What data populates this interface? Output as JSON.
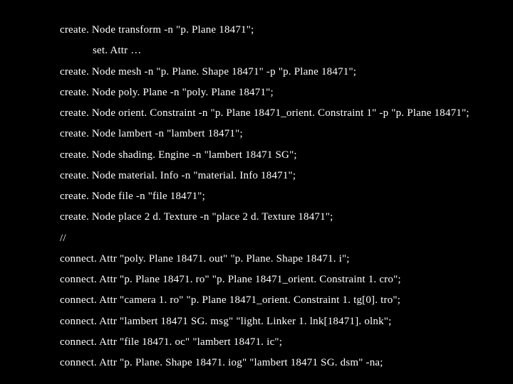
{
  "code": {
    "lines": [
      {
        "text": "create. Node transform -n \"p. Plane 18471\";",
        "indent": false
      },
      {
        "text": "set. Attr …",
        "indent": true
      },
      {
        "text": "create. Node mesh -n \"p. Plane. Shape 18471\" -p \"p. Plane 18471\";",
        "indent": false
      },
      {
        "text": "create. Node poly. Plane -n \"poly. Plane 18471\";",
        "indent": false
      },
      {
        "text": "create. Node orient. Constraint -n \"p. Plane 18471_orient. Constraint 1\" -p \"p. Plane 18471\";",
        "indent": false
      },
      {
        "text": "create. Node lambert -n \"lambert 18471\";",
        "indent": false
      },
      {
        "text": "create. Node shading. Engine -n \"lambert 18471 SG\";",
        "indent": false
      },
      {
        "text": "create. Node material. Info -n \"material. Info 18471\";",
        "indent": false
      },
      {
        "text": "create. Node file -n \"file 18471\";",
        "indent": false
      },
      {
        "text": "create. Node place 2 d. Texture -n \"place 2 d. Texture 18471\";",
        "indent": false
      },
      {
        "text": "//",
        "indent": false
      },
      {
        "text": "connect. Attr \"poly. Plane 18471. out\" \"p. Plane. Shape 18471. i\";",
        "indent": false
      },
      {
        "text": "connect. Attr \"p. Plane 18471. ro\" \"p. Plane 18471_orient. Constraint 1. cro\";",
        "indent": false
      },
      {
        "text": "connect. Attr \"camera 1. ro\" \"p. Plane 18471_orient. Constraint 1. tg[0]. tro\";",
        "indent": false
      },
      {
        "text": "connect. Attr \"lambert 18471 SG. msg\" \"light. Linker 1. lnk[18471]. olnk\";",
        "indent": false
      },
      {
        "text": "connect. Attr \"file 18471. oc\" \"lambert 18471. ic\";",
        "indent": false
      },
      {
        "text": "connect. Attr \"p. Plane. Shape 18471. iog\" \"lambert 18471 SG. dsm\" -na;",
        "indent": false
      }
    ]
  }
}
